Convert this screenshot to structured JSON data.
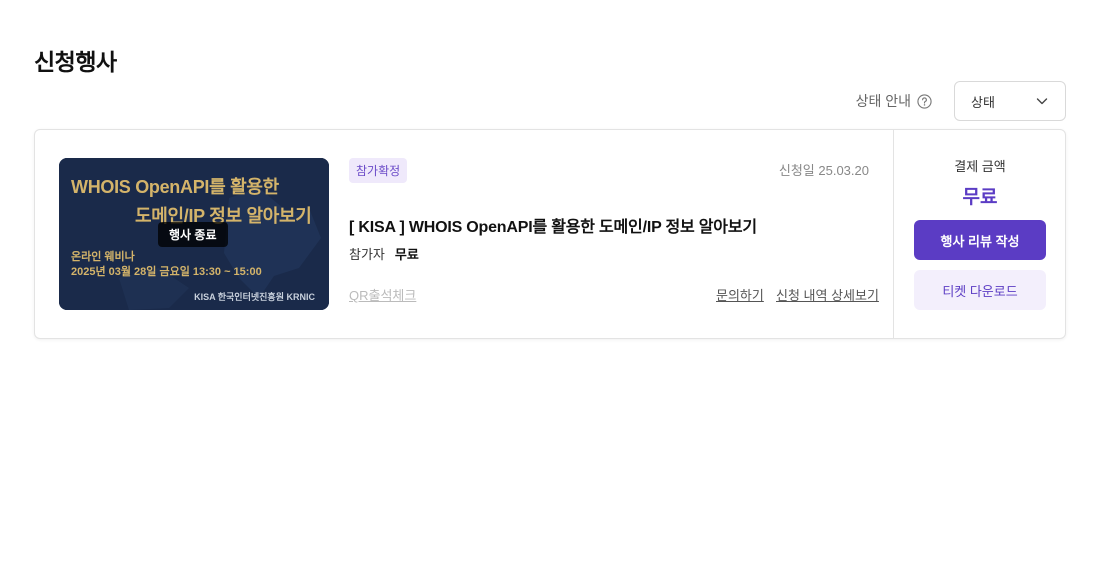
{
  "page": {
    "title": "신청행사"
  },
  "filters": {
    "status_guide_label": "상태 안내",
    "status_select_value": "상태"
  },
  "event": {
    "thumbnail": {
      "line1": "WHOIS OpenAPI를 활용한",
      "line2": "도메인/IP 정보 알아보기",
      "sub1": "온라인 웨비나",
      "sub2": "2025년 03월 28일 금요일 13:30 ~ 15:00",
      "org": "KISA 한국인터넷진흥원 KRNIC",
      "ended_badge": "행사 종료"
    },
    "status_tag": "참가확정",
    "apply_date": "신청일 25.03.20",
    "title": "[ KISA ] WHOIS OpenAPI를 활용한 도메인/IP 정보 알아보기",
    "attendee_label": "참가자",
    "attendee_value": "무료",
    "qr_link": "QR출석체크",
    "inquiry_link": "문의하기",
    "detail_link": "신청 내역 상세보기",
    "payment_label": "결제 금액",
    "payment_value": "무료",
    "review_button": "행사 리뷰 작성",
    "ticket_button": "티켓 다운로드"
  },
  "colors": {
    "accent": "#5b3cc4",
    "accent_light": "#f3effc",
    "thumbnail_bg": "#1a2a4a",
    "thumbnail_text": "#d4b46a"
  },
  "icons": {
    "help": "question-circle-icon",
    "dropdown": "chevron-down-icon"
  }
}
